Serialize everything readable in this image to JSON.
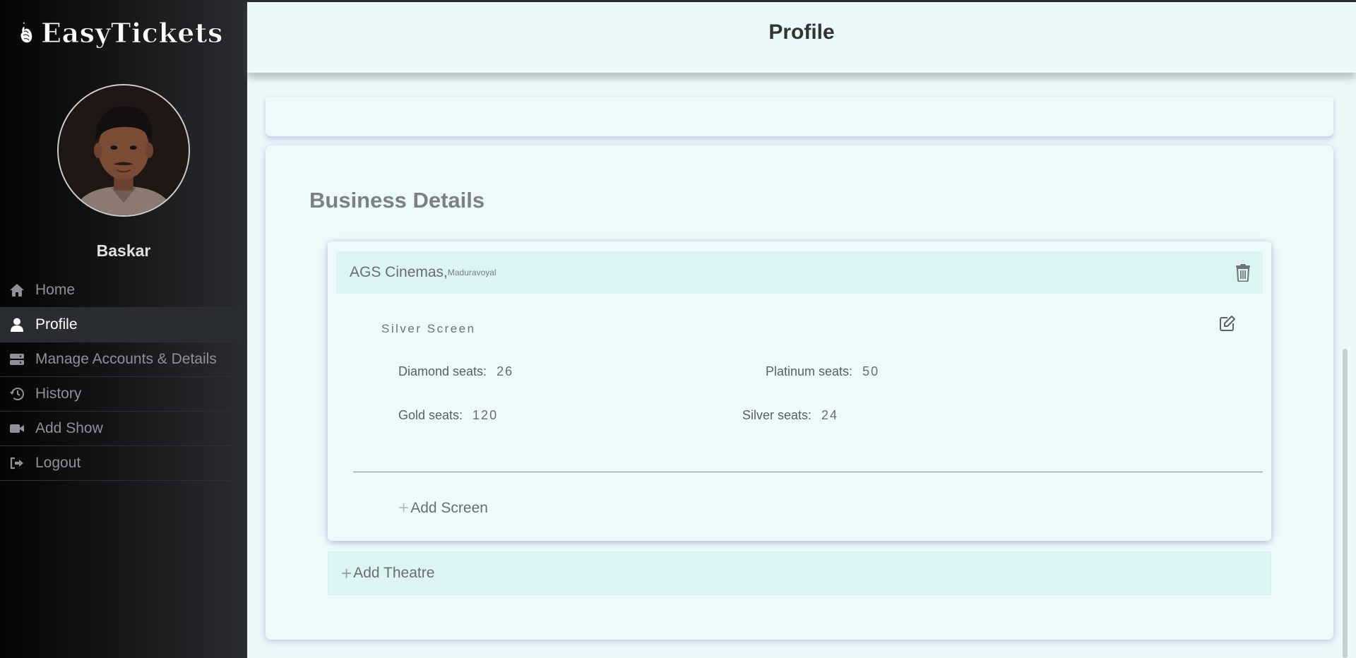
{
  "app": {
    "brand": "EasyTickets"
  },
  "user": {
    "name": "Baskar"
  },
  "sidebar": {
    "items": [
      {
        "label": "Home",
        "icon": "home-icon"
      },
      {
        "label": "Profile",
        "icon": "user-icon",
        "active": true
      },
      {
        "label": "Manage Accounts & Details",
        "icon": "server-icon"
      },
      {
        "label": "History",
        "icon": "history-icon"
      },
      {
        "label": "Add Show",
        "icon": "video-icon"
      },
      {
        "label": "Logout",
        "icon": "logout-icon"
      }
    ]
  },
  "header": {
    "title": "Profile"
  },
  "business": {
    "title": "Business Details",
    "theatre": {
      "name": "AGS Cinemas,",
      "location": "Maduravoyal",
      "screen": {
        "name": "Silver Screen",
        "diamond_label": "Diamond seats:",
        "diamond_value": "26",
        "platinum_label": "Platinum seats:",
        "platinum_value": "50",
        "gold_label": "Gold seats:",
        "gold_value": "120",
        "silver_label": "Silver seats:",
        "silver_value": "24"
      },
      "add_screen_label": "Add Screen"
    },
    "add_theatre_label": "Add Theatre"
  },
  "colors": {
    "background": "#eafaf9",
    "theatre_header": "#dcf4f4",
    "sidebar_dark": "#050505",
    "sidebar_light": "#2a2d30"
  }
}
